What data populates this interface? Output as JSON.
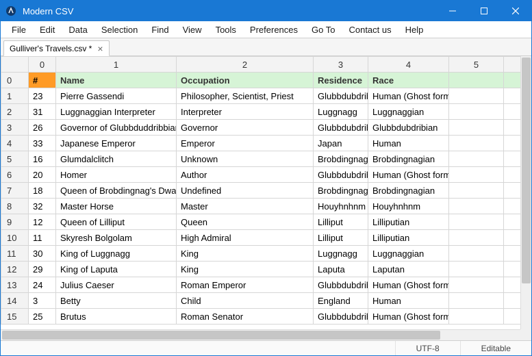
{
  "app": {
    "title": "Modern CSV"
  },
  "menu": [
    "File",
    "Edit",
    "Data",
    "Selection",
    "Find",
    "View",
    "Tools",
    "Preferences",
    "Go To",
    "Contact us",
    "Help"
  ],
  "tab": {
    "label": "Gulliver's Travels.csv *"
  },
  "columns": [
    "0",
    "1",
    "2",
    "3",
    "4",
    "5"
  ],
  "header_row": {
    "index": "0",
    "cells": [
      "#",
      "Name",
      "Occupation",
      "Residence",
      "Race",
      ""
    ]
  },
  "rows": [
    {
      "index": "1",
      "cells": [
        "23",
        "Pierre Gassendi",
        "Philosopher, Scientist, Priest",
        "Glubbdubdrib",
        "Human (Ghost form)",
        ""
      ]
    },
    {
      "index": "2",
      "cells": [
        "31",
        "Luggnaggian Interpreter",
        "Interpreter",
        "Luggnagg",
        "Luggnaggian",
        ""
      ]
    },
    {
      "index": "3",
      "cells": [
        "26",
        "Governor of Glubbduddribbian",
        "Governor",
        "Glubbdubdrib",
        "Glubbdubdribian",
        ""
      ]
    },
    {
      "index": "4",
      "cells": [
        "33",
        "Japanese Emperor",
        "Emperor",
        "Japan",
        "Human",
        ""
      ]
    },
    {
      "index": "5",
      "cells": [
        "16",
        "Glumdalclitch",
        "Unknown",
        "Brobdingnag",
        "Brobdingnagian",
        ""
      ]
    },
    {
      "index": "6",
      "cells": [
        "20",
        "Homer",
        "Author",
        "Glubbdubdrib",
        "Human (Ghost form)",
        ""
      ]
    },
    {
      "index": "7",
      "cells": [
        "18",
        "Queen of Brobdingnag's Dwarf",
        "Undefined",
        "Brobdingnag",
        "Brobdingnagian",
        ""
      ]
    },
    {
      "index": "8",
      "cells": [
        "32",
        "Master Horse",
        "Master",
        "Houyhnhnm",
        "Houyhnhnm",
        ""
      ]
    },
    {
      "index": "9",
      "cells": [
        "12",
        "Queen of Lilliput",
        "Queen",
        "Lilliput",
        "Lilliputian",
        ""
      ]
    },
    {
      "index": "10",
      "cells": [
        "11",
        "Skyresh Bolgolam",
        "High Admiral",
        "Lilliput",
        "Lilliputian",
        ""
      ]
    },
    {
      "index": "11",
      "cells": [
        "30",
        "King of Luggnagg",
        "King",
        "Luggnagg",
        "Luggnaggian",
        ""
      ]
    },
    {
      "index": "12",
      "cells": [
        "29",
        "King of Laputa",
        "King",
        "Laputa",
        "Laputan",
        ""
      ]
    },
    {
      "index": "13",
      "cells": [
        "24",
        "Julius Caeser",
        "Roman Emperor",
        "Glubbdubdrib",
        "Human (Ghost form)",
        ""
      ]
    },
    {
      "index": "14",
      "cells": [
        "3",
        "Betty",
        "Child",
        "England",
        "Human",
        ""
      ]
    },
    {
      "index": "15",
      "cells": [
        "25",
        "Brutus",
        "Roman Senator",
        "Glubbdubdrib",
        "Human (Ghost form)",
        ""
      ]
    }
  ],
  "status": {
    "encoding": "UTF-8",
    "mode": "Editable"
  }
}
